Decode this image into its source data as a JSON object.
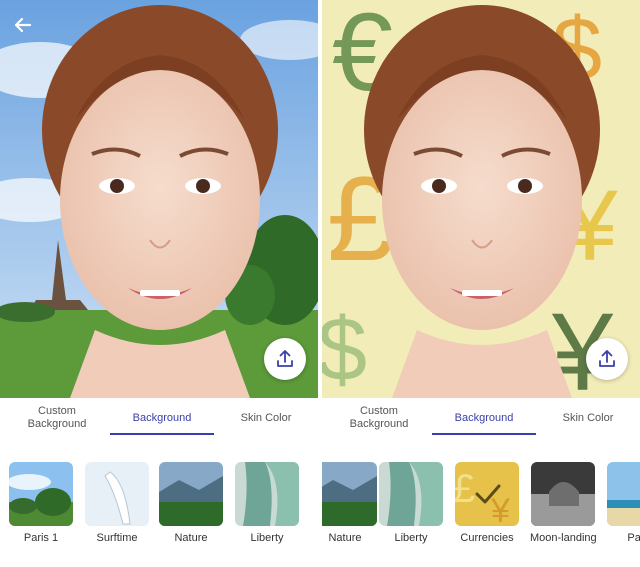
{
  "panels": [
    {
      "id": "left",
      "tabs": [
        "Custom Background",
        "Background",
        "Skin Color"
      ],
      "active_tab": "Background",
      "thumbnails": [
        "Paris 1",
        "Surftime",
        "Nature",
        "Liberty"
      ],
      "background": "paris"
    },
    {
      "id": "right",
      "tabs": [
        "Custom Background",
        "Background",
        "Skin Color"
      ],
      "active_tab": "Background",
      "thumbnails": [
        "Nature",
        "Liberty",
        "Currencies",
        "Moon-landing",
        "Para"
      ],
      "selected_thumbnail": "Currencies",
      "background": "currencies"
    }
  ],
  "icons": {
    "back": "arrow-left-icon",
    "share": "upload-icon",
    "selected": "checkmark-icon"
  },
  "colors": {
    "accent": "#3b3fa8",
    "share_icon": "#3b3fa8"
  }
}
